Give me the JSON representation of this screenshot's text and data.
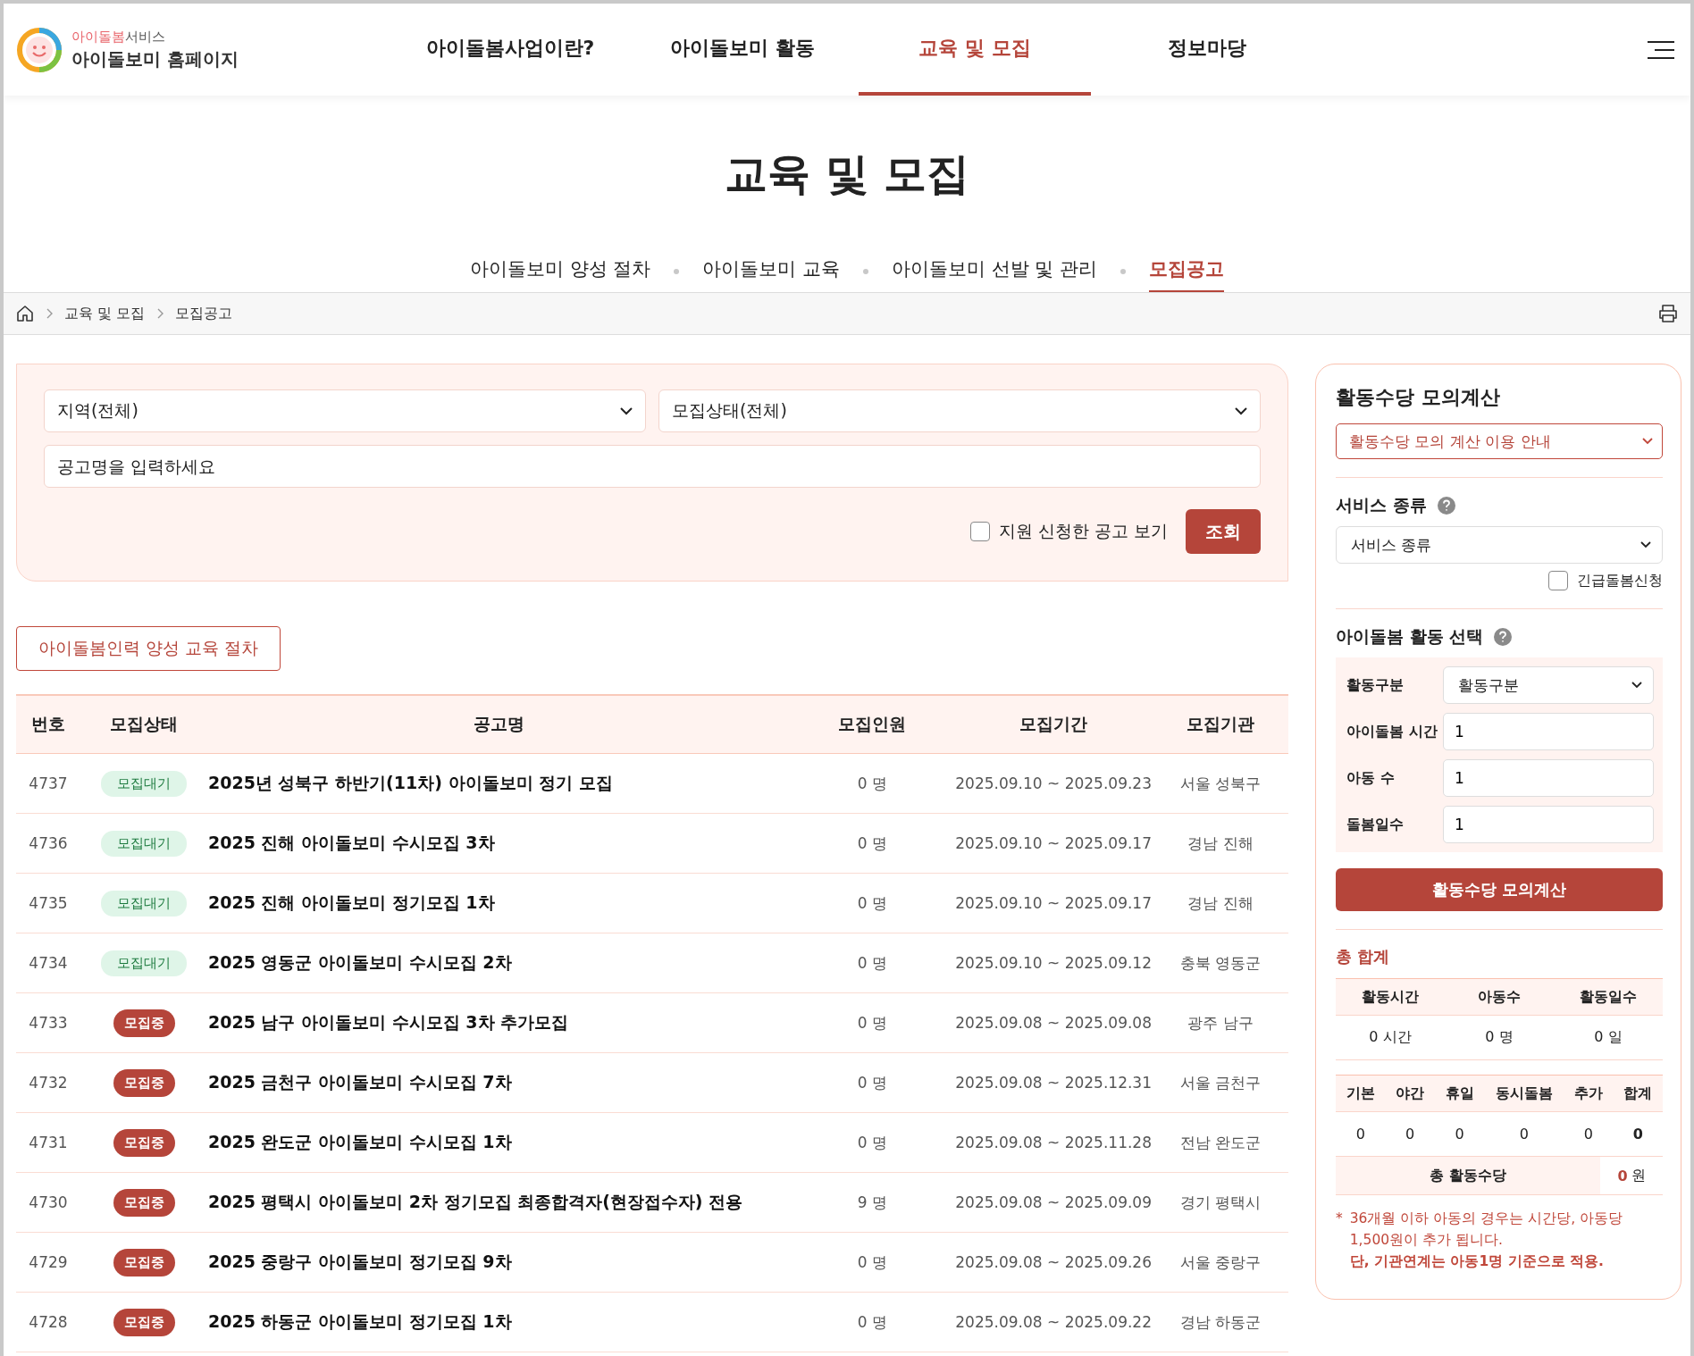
{
  "logo": {
    "service_red": "아이돌봄",
    "service_rest": "서비스",
    "title": "아이돌보미 홈페이지"
  },
  "nav": [
    {
      "label": "아이돌봄사업이란?",
      "selected": false
    },
    {
      "label": "아이돌보미 활동",
      "selected": false
    },
    {
      "label": "교육 및 모집",
      "selected": true
    },
    {
      "label": "정보마당",
      "selected": false
    }
  ],
  "page_title": "교육 및 모집",
  "subtabs": [
    {
      "label": "아이돌보미 양성 절차",
      "selected": false
    },
    {
      "label": "아이돌보미 교육",
      "selected": false
    },
    {
      "label": "아이돌보미 선발 및 관리",
      "selected": false
    },
    {
      "label": "모집공고",
      "selected": true
    }
  ],
  "breadcrumb": [
    "교육 및 모집",
    "모집공고"
  ],
  "filter": {
    "region": "지역(전체)",
    "status": "모집상태(전체)",
    "search": {
      "placeholder": "공고명을 입력하세요"
    },
    "applied_only": {
      "label": "지원 신청한 공고 보기",
      "checked": false
    },
    "submit": "조회"
  },
  "procedure_button": "아이돌봄인력 양성 교육 절차",
  "table": {
    "columns": [
      "번호",
      "모집상태",
      "공고명",
      "모집인원",
      "모집기간",
      "모집기관"
    ],
    "rows": [
      {
        "no": "4737",
        "status": "모집대기",
        "kind": "waiting",
        "title": "2025년 성북구 하반기(11차) 아이돌보미 정기 모집",
        "count": "0 명",
        "period": "2025.09.10 ~ 2025.09.23",
        "org": "서울 성북구"
      },
      {
        "no": "4736",
        "status": "모집대기",
        "kind": "waiting",
        "title": "2025 진해 아이돌보미 수시모집 3차",
        "count": "0 명",
        "period": "2025.09.10 ~ 2025.09.17",
        "org": "경남 진해"
      },
      {
        "no": "4735",
        "status": "모집대기",
        "kind": "waiting",
        "title": "2025 진해 아이돌보미 정기모집 1차",
        "count": "0 명",
        "period": "2025.09.10 ~ 2025.09.17",
        "org": "경남 진해"
      },
      {
        "no": "4734",
        "status": "모집대기",
        "kind": "waiting",
        "title": "2025 영동군 아이돌보미 수시모집 2차",
        "count": "0 명",
        "period": "2025.09.10 ~ 2025.09.12",
        "org": "충북 영동군"
      },
      {
        "no": "4733",
        "status": "모집중",
        "kind": "open",
        "title": "2025 남구 아이돌보미 수시모집 3차 추가모집",
        "count": "0 명",
        "period": "2025.09.08 ~ 2025.09.08",
        "org": "광주 남구"
      },
      {
        "no": "4732",
        "status": "모집중",
        "kind": "open",
        "title": "2025 금천구 아이돌보미 수시모집 7차",
        "count": "0 명",
        "period": "2025.09.08 ~ 2025.12.31",
        "org": "서울 금천구"
      },
      {
        "no": "4731",
        "status": "모집중",
        "kind": "open",
        "title": "2025 완도군 아이돌보미 수시모집 1차",
        "count": "0 명",
        "period": "2025.09.08 ~ 2025.11.28",
        "org": "전남 완도군"
      },
      {
        "no": "4730",
        "status": "모집중",
        "kind": "open",
        "title": "2025 평택시 아이돌보미 2차 정기모집 최종합격자(현장접수자) 전용",
        "count": "9 명",
        "period": "2025.09.08 ~ 2025.09.09",
        "org": "경기 평택시"
      },
      {
        "no": "4729",
        "status": "모집중",
        "kind": "open",
        "title": "2025 중랑구 아이돌보미 정기모집 9차",
        "count": "0 명",
        "period": "2025.09.08 ~ 2025.09.26",
        "org": "서울 중랑구"
      },
      {
        "no": "4728",
        "status": "모집중",
        "kind": "open",
        "title": "2025 하동군 아이돌보미 정기모집 1차",
        "count": "0 명",
        "period": "2025.09.08 ~ 2025.09.22",
        "org": "경남 하동군"
      }
    ]
  },
  "calculator": {
    "title": "활동수당 모의계산",
    "guide": "활동수당 모의 계산 이용 안내",
    "service_label": "서비스 종류",
    "service_select": "서비스 종류",
    "urgent": {
      "label": "긴급돌봄신청",
      "checked": false
    },
    "activity_label": "아이돌봄 활동 선택",
    "fields": [
      {
        "label": "활동구분",
        "kind": "select",
        "value": "활동구분"
      },
      {
        "label": "아이돌봄 시간",
        "kind": "input",
        "value": "1"
      },
      {
        "label": "아동 수",
        "kind": "input",
        "value": "1"
      },
      {
        "label": "돌봄일수",
        "kind": "input",
        "value": "1"
      }
    ],
    "button": "활동수당 모의계산",
    "totals_title": "총 합계",
    "summary": {
      "columns": [
        "활동시간",
        "아동수",
        "활동일수"
      ],
      "values": [
        "0 시간",
        "0 명",
        "0 일"
      ]
    },
    "breakdown": {
      "columns": [
        "기본",
        "야간",
        "휴일",
        "동시돌봄",
        "추가",
        "합계"
      ],
      "values": [
        "0",
        "0",
        "0",
        "0",
        "0",
        "0"
      ]
    },
    "total_label": "총 활동수당",
    "total_amount": "0",
    "total_unit": "원",
    "note_mark": "*",
    "note": "36개월 이하 아동의 경우는 시간당, 아동당 1,500원이 추가 됩니다.",
    "note_emphasis": "단, 기관연계는 아동1명 기준으로 적용."
  }
}
